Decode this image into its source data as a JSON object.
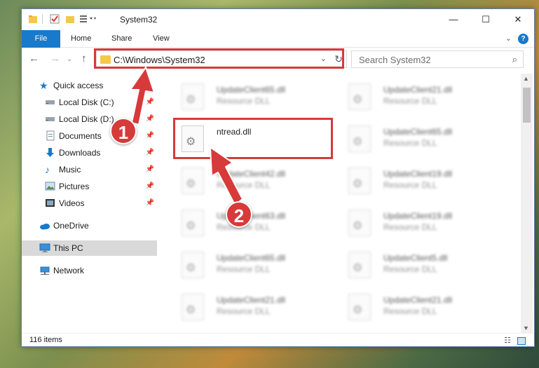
{
  "window": {
    "title": "System32",
    "controls": {
      "minimize": "—",
      "maximize": "☐",
      "close": "✕"
    }
  },
  "ribbon": {
    "tabs": [
      "File",
      "Home",
      "Share",
      "View"
    ],
    "expand": "⌄",
    "help": "?"
  },
  "address": {
    "path": "C:\\Windows\\System32",
    "dropdown": "⌄",
    "refresh": "↻"
  },
  "search": {
    "placeholder": "Search System32"
  },
  "nav": {
    "items": [
      {
        "label": "Quick access",
        "icon": "star-icon",
        "pinned": false
      },
      {
        "label": "Local Disk (C:)",
        "icon": "drive-icon",
        "pinned": true
      },
      {
        "label": "Local Disk (D:)",
        "icon": "drive-icon",
        "pinned": true
      },
      {
        "label": "Documents",
        "icon": "documents-icon",
        "pinned": true
      },
      {
        "label": "Downloads",
        "icon": "download-icon",
        "pinned": true
      },
      {
        "label": "Music",
        "icon": "music-icon",
        "pinned": true
      },
      {
        "label": "Pictures",
        "icon": "pictures-icon",
        "pinned": true
      },
      {
        "label": "Videos",
        "icon": "videos-icon",
        "pinned": true
      },
      {
        "label": "OneDrive",
        "icon": "cloud-icon",
        "pinned": false
      },
      {
        "label": "This PC",
        "icon": "computer-icon",
        "pinned": false
      },
      {
        "label": "Network",
        "icon": "network-icon",
        "pinned": false
      }
    ]
  },
  "files": {
    "left": [
      {
        "name": "UpdateClient65.dll",
        "type": "Resource DLL"
      },
      {
        "name": "ntread.dll",
        "type": ""
      },
      {
        "name": "UpdateClient42.dll",
        "type": "Resource DLL"
      },
      {
        "name": "UpdateClient63.dll",
        "type": "Resource DLL"
      },
      {
        "name": "UpdateClient65.dll",
        "type": "Resource DLL"
      },
      {
        "name": "UpdateClient21.dll",
        "type": "Resource DLL"
      }
    ],
    "right": [
      {
        "name": "UpdateClient21.dll",
        "type": "Resource DLL"
      },
      {
        "name": "UpdateClient65.dll",
        "type": "Resource DLL"
      },
      {
        "name": "UpdateClient19.dll",
        "type": "Resource DLL"
      },
      {
        "name": "UpdateClient19.dll",
        "type": "Resource DLL"
      },
      {
        "name": "UpdateClient5.dll",
        "type": "Resource DLL"
      },
      {
        "name": "UpdateClient21.dll",
        "type": "Resource DLL"
      }
    ]
  },
  "status": {
    "count": "116 items"
  },
  "annotations": {
    "badge1": "1",
    "badge2": "2"
  },
  "colors": {
    "accent": "#1979ca",
    "highlight": "#d63a3a",
    "folder": "#f5c84c"
  }
}
